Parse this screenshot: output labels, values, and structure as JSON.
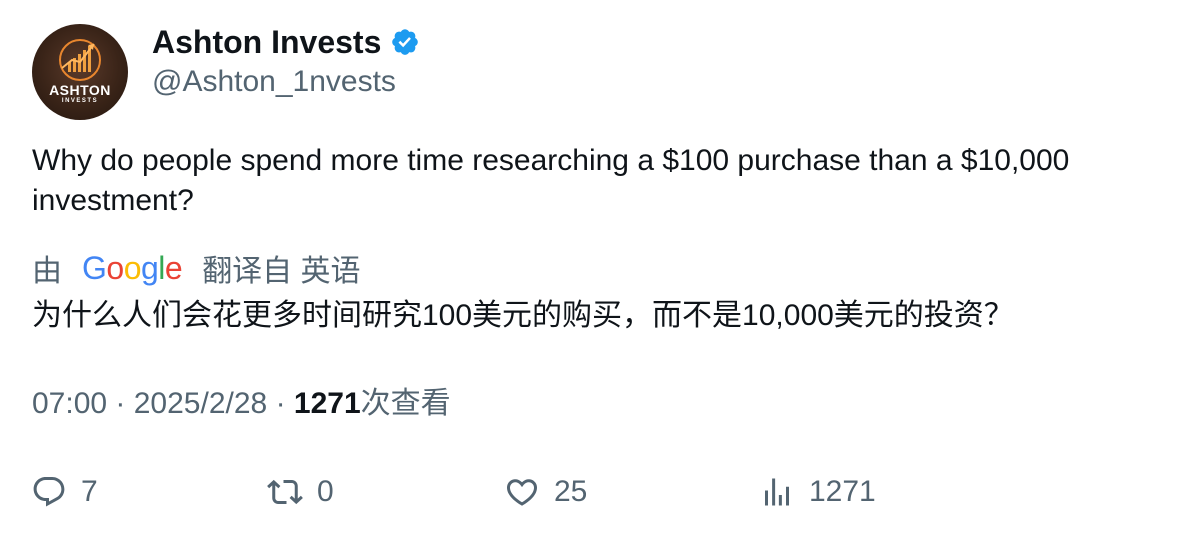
{
  "author": {
    "display_name": "Ashton Invests",
    "handle": "@Ashton_1nvests",
    "avatar_label_main": "ASHTON",
    "avatar_label_sub": "INVESTS",
    "verified_icon": "verified-badge-icon"
  },
  "tweet": {
    "text": "Why do people spend more time researching a $100 purchase than a $10,000 investment?"
  },
  "translation": {
    "prefix": "由",
    "provider": "Google",
    "suffix": "翻译自 英语",
    "text": "为什么人们会花更多时间研究100美元的购买，而不是10,000美元的投资？"
  },
  "meta": {
    "time": "07:00",
    "separator": "·",
    "date": "2025/2/28",
    "views_count": "1271",
    "views_label": "次查看"
  },
  "actions": {
    "reply": {
      "icon": "reply-icon",
      "count": "7"
    },
    "retweet": {
      "icon": "retweet-icon",
      "count": "0"
    },
    "like": {
      "icon": "like-icon",
      "count": "25"
    },
    "views": {
      "icon": "views-icon",
      "count": "1271"
    }
  },
  "colors": {
    "text_primary": "#0f1419",
    "text_secondary": "#536471",
    "verified_blue": "#1d9bf0",
    "google_blue": "#4285f4",
    "google_red": "#ea4335",
    "google_yellow": "#fbbc05",
    "google_green": "#34a853"
  }
}
